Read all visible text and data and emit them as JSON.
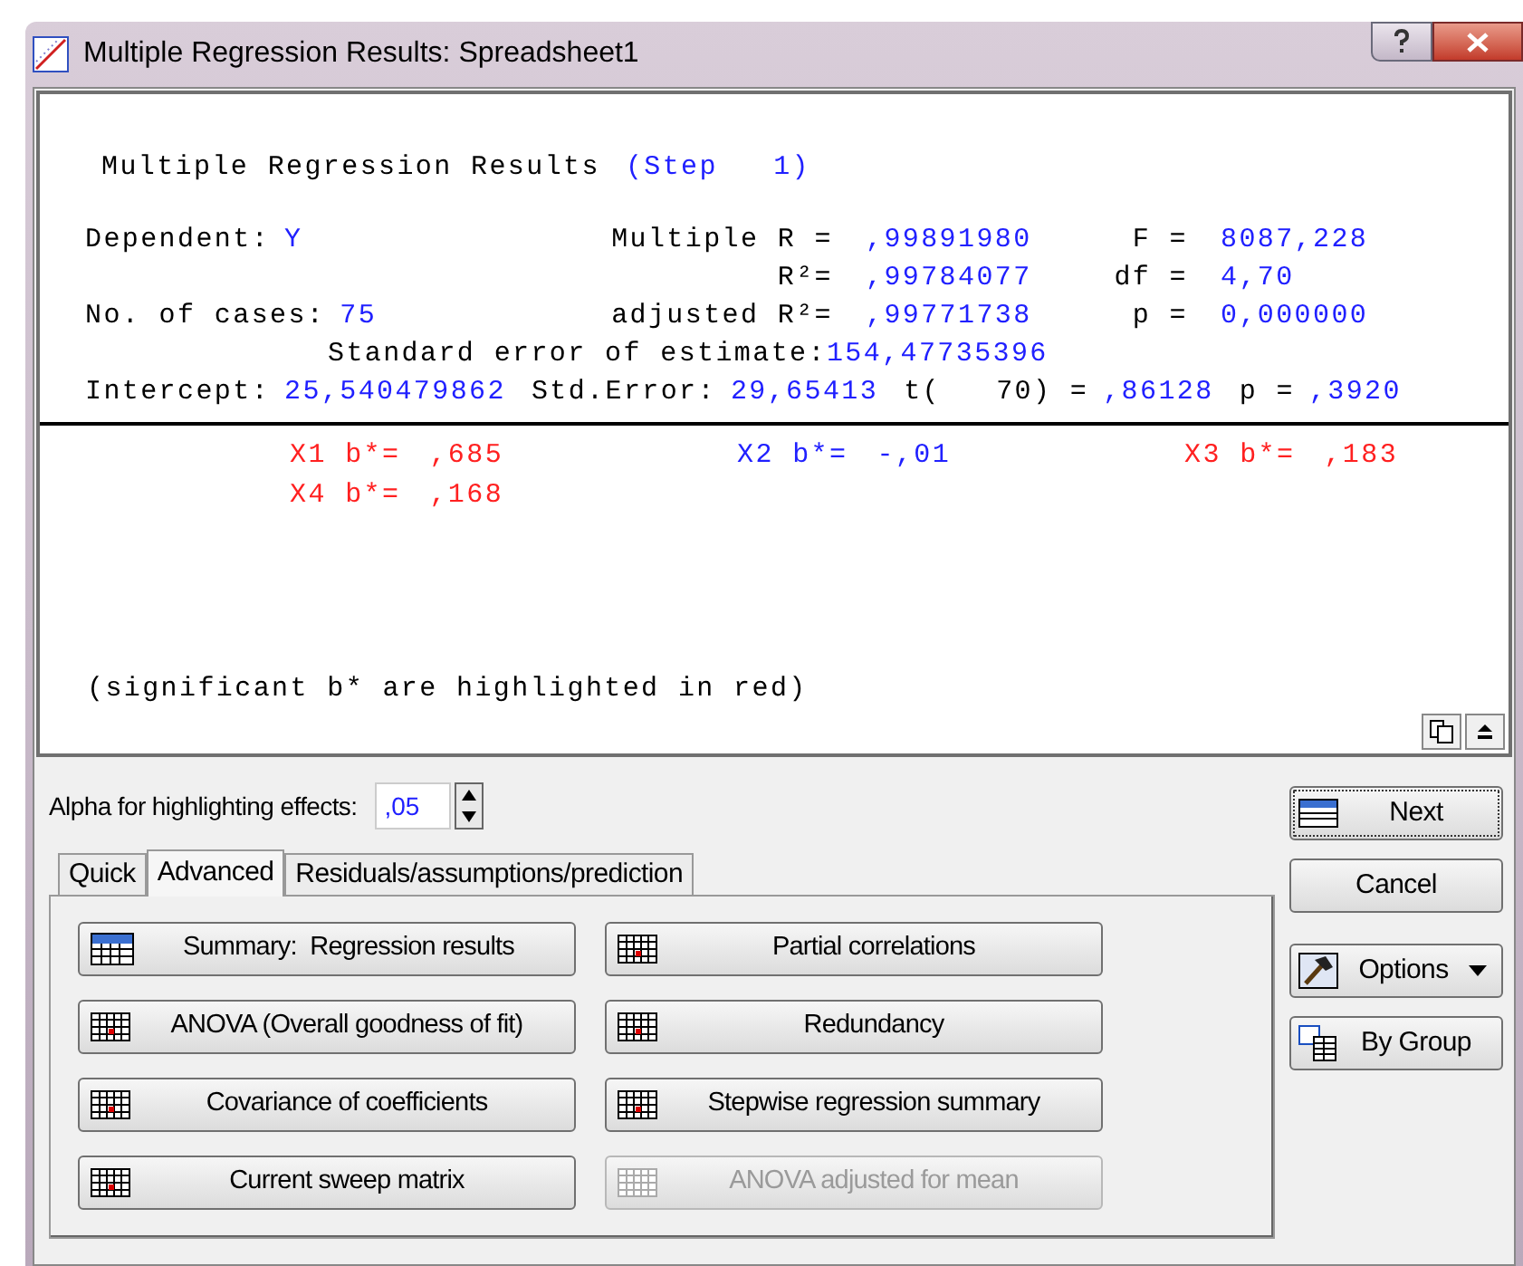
{
  "window": {
    "title": "Multiple Regression Results: Spreadsheet1"
  },
  "report": {
    "heading": "Multiple Regression Results",
    "step": "(Step   1)",
    "stats": [
      {
        "left": {
          "label": "Dependent:",
          "value": "Y"
        },
        "middle": {
          "label": "Multiple R =",
          "value": ",99891980"
        },
        "right": {
          "label": "F =",
          "value": "8087,228"
        }
      },
      {
        "middle": {
          "label": "R²=",
          "value": ",99784077"
        },
        "right": {
          "label": "df =",
          "value": "4,70"
        }
      },
      {
        "left": {
          "label": "No. of cases:",
          "value": "75"
        },
        "middle": {
          "label": "adjusted R²=",
          "value": ",99771738"
        },
        "right": {
          "label": "p =",
          "value": "0,000000"
        }
      }
    ],
    "std_error": {
      "label": "Standard error of estimate:",
      "value": "154,47735396"
    },
    "intercept": [
      {
        "label": "Intercept:",
        "value": "25,540479862"
      },
      {
        "label": "Std.Error:",
        "value": "29,65413"
      },
      {
        "label": "t(   70) =",
        "value": ",86128"
      },
      {
        "label": "p =",
        "value": ",3920"
      }
    ],
    "coefficients": [
      {
        "label": "X1 b*=",
        "value": ",685",
        "significant": true
      },
      {
        "label": "X2 b*=",
        "value": "-,01",
        "significant": false
      },
      {
        "label": "X3 b*=",
        "value": ",183",
        "significant": true
      },
      {
        "label": "X4 b*=",
        "value": ",168",
        "significant": true
      }
    ],
    "note": "(significant b* are highlighted in red)"
  },
  "alpha": {
    "label": "Alpha for highlighting effects:",
    "value": ",05"
  },
  "tabs": [
    {
      "label": "Quick",
      "selected": false
    },
    {
      "label": "Advanced",
      "selected": true
    },
    {
      "label": "Residuals/assumptions/prediction",
      "selected": false
    }
  ],
  "actions": [
    {
      "label": "Summary:  Regression results",
      "kind": "summary",
      "disabled": false
    },
    {
      "label": "Partial correlations",
      "kind": "table",
      "disabled": false
    },
    {
      "label": "ANOVA (Overall goodness of fit)",
      "kind": "table",
      "disabled": false
    },
    {
      "label": "Redundancy",
      "kind": "table",
      "disabled": false
    },
    {
      "label": "Covariance of coefficients",
      "kind": "table",
      "disabled": false
    },
    {
      "label": "Stepwise regression summary",
      "kind": "table",
      "disabled": false
    },
    {
      "label": "Current sweep matrix",
      "kind": "table",
      "disabled": false
    },
    {
      "label": "ANOVA adjusted for mean",
      "kind": "table",
      "disabled": true
    }
  ],
  "side_buttons": [
    {
      "label": "Next",
      "kind": "next"
    },
    {
      "label": "Cancel",
      "kind": "plain"
    },
    {
      "label": "Options",
      "kind": "options"
    },
    {
      "label": "By Group",
      "kind": "bygroup"
    }
  ]
}
